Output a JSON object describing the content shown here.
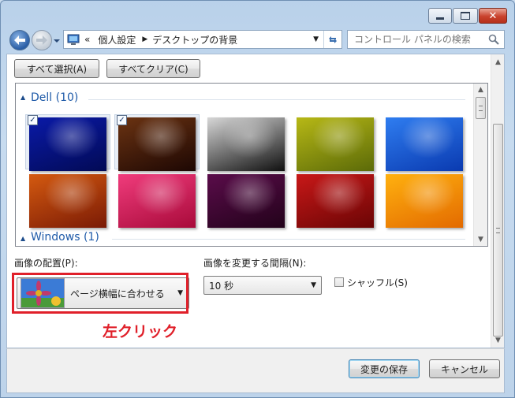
{
  "window": {
    "controls": {
      "minimize_icon": "minimize-icon",
      "maximize_icon": "maximize-icon",
      "close_icon": "close-icon"
    }
  },
  "nav": {
    "breadcrumb_prefix": "«",
    "breadcrumb": [
      "個人設定",
      "デスクトップの背景"
    ],
    "search_placeholder": "コントロール パネルの検索"
  },
  "toolbar": {
    "select_all": "すべて選択(A)",
    "clear_all": "すべてクリア(C)"
  },
  "gallery": {
    "groups": [
      {
        "label": "Dell (10)",
        "items": [
          {
            "name": "wallpaper-dell-1",
            "checked": true,
            "color_a": "#0a1aa8",
            "color_b": "#020a55"
          },
          {
            "name": "wallpaper-dell-2",
            "checked": true,
            "color_a": "#6b3312",
            "color_b": "#1d0703"
          },
          {
            "name": "wallpaper-dell-3",
            "checked": false,
            "color_a": "#d7d7d7",
            "color_b": "#101010"
          },
          {
            "name": "wallpaper-dell-4",
            "checked": false,
            "color_a": "#b7b816",
            "color_b": "#5b6a08"
          },
          {
            "name": "wallpaper-dell-5",
            "checked": false,
            "color_a": "#2f7df0",
            "color_b": "#0a3ab0"
          },
          {
            "name": "wallpaper-dell-6",
            "checked": false,
            "color_a": "#d45a10",
            "color_b": "#7a1a05"
          },
          {
            "name": "wallpaper-dell-7",
            "checked": false,
            "color_a": "#f03c7c",
            "color_b": "#a80a3a"
          },
          {
            "name": "wallpaper-dell-8",
            "checked": false,
            "color_a": "#5a0c4a",
            "color_b": "#22021a"
          },
          {
            "name": "wallpaper-dell-9",
            "checked": false,
            "color_a": "#c81818",
            "color_b": "#6a0505"
          },
          {
            "name": "wallpaper-dell-10",
            "checked": false,
            "color_a": "#ffb10f",
            "color_b": "#e36a00"
          }
        ]
      },
      {
        "label": "Windows (1)",
        "items": []
      }
    ]
  },
  "position": {
    "label": "画像の配置(P):",
    "value": "ページ横幅に合わせる"
  },
  "interval": {
    "label": "画像を変更する間隔(N):",
    "value": "10 秒"
  },
  "shuffle": {
    "label": "シャッフル(S)",
    "checked": false
  },
  "annotation": {
    "text": "左クリック",
    "color": "#e0202a"
  },
  "footer": {
    "save": "変更の保存",
    "cancel": "キャンセル"
  }
}
